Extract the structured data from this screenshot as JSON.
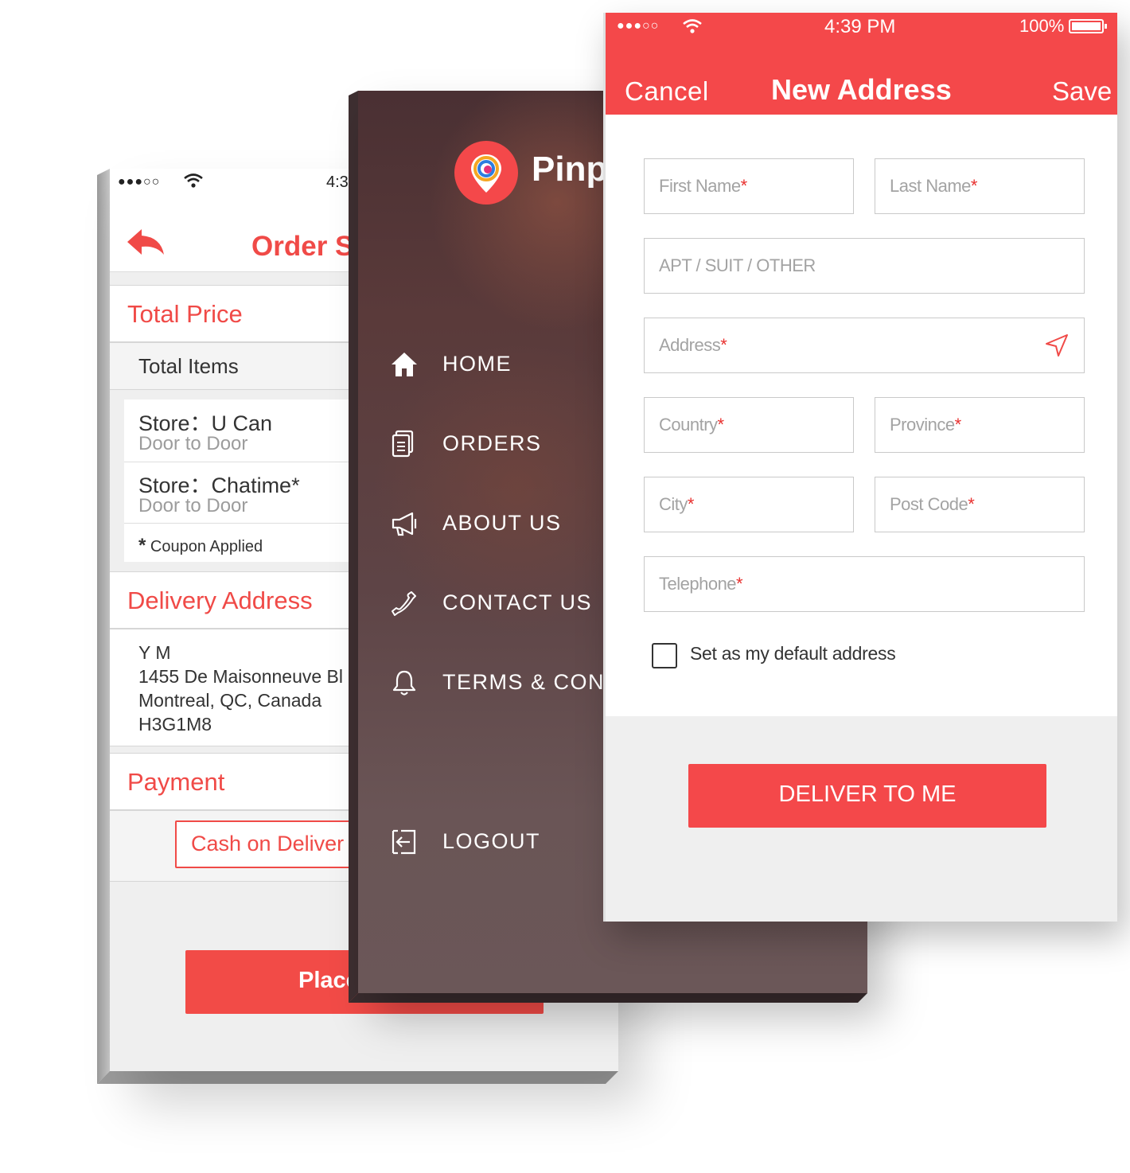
{
  "colors": {
    "accent": "#f4484a",
    "menu_bg": "#5a3a3a",
    "footer_bg": "#efefef"
  },
  "order_screen": {
    "status": {
      "signal": "●●●○○",
      "time": "4:3"
    },
    "title": "Order S",
    "total_price_header": "Total Price",
    "total_items_label": "Total Items",
    "stores": [
      {
        "name": "Store：U Can",
        "method": "Door to Door"
      },
      {
        "name": "Store：Chatime*",
        "method": "Door to Door"
      }
    ],
    "coupon_note_star": "*",
    "coupon_note": "Coupon Applied",
    "delivery_header": "Delivery Address",
    "address_lines": [
      "Y M",
      "1455 De Maisonneuve Bl",
      "Montreal, QC, Canada",
      "H3G1M8"
    ],
    "payment_header": "Payment",
    "payment_option": "Cash on Deliver",
    "place_button": "Place"
  },
  "menu_screen": {
    "brand": "Pinp",
    "items": [
      {
        "label": "HOME",
        "icon": "home-icon"
      },
      {
        "label": "ORDERS",
        "icon": "orders-icon"
      },
      {
        "label": "ABOUT US",
        "icon": "megaphone-icon"
      },
      {
        "label": "CONTACT US",
        "icon": "phone-icon"
      },
      {
        "label": "TERMS & CONDI",
        "icon": "bell-icon"
      },
      {
        "label": "LOGOUT",
        "icon": "logout-icon"
      }
    ]
  },
  "address_screen": {
    "status": {
      "signal": "●●●○○",
      "time": "4:39 PM",
      "battery": "100%"
    },
    "cancel": "Cancel",
    "title": "New Address",
    "save": "Save",
    "fields": {
      "first_name": "First Name",
      "last_name": "Last Name",
      "apt": "APT /  SUIT / OTHER",
      "address": "Address",
      "country": "Country",
      "province": "Province",
      "city": "City",
      "post_code": "Post Code",
      "telephone": "Telephone"
    },
    "required_mark": "*",
    "default_checkbox": {
      "label": "Set as my default address",
      "checked": false
    },
    "deliver_button": "DELIVER TO ME"
  }
}
